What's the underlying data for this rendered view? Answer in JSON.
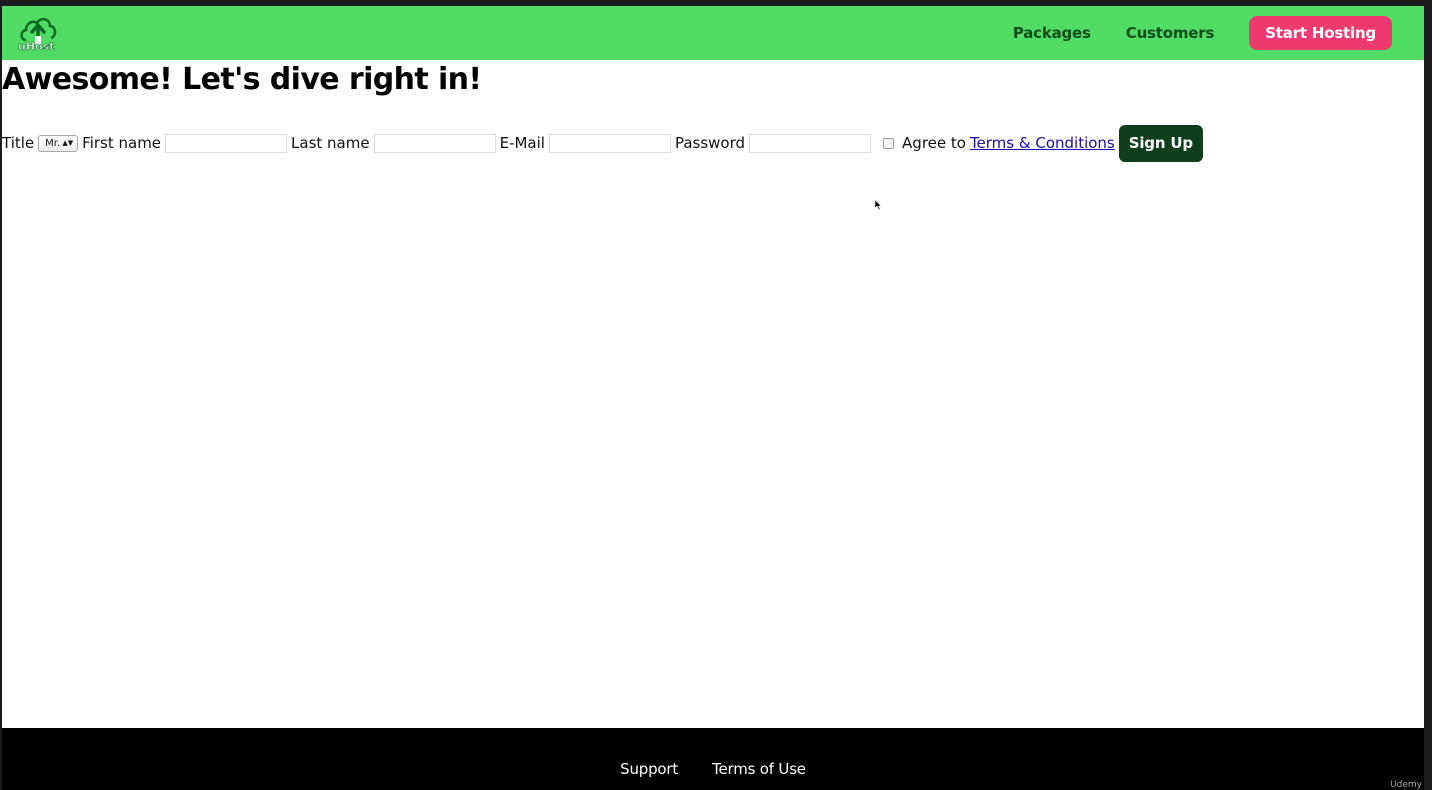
{
  "brand": {
    "logo_text": "uHost",
    "colors": {
      "header": "#51dc65",
      "cta": "#ef3a6f",
      "signup": "#0f3e1c",
      "footer": "#000000"
    }
  },
  "nav": {
    "links": [
      "Packages",
      "Customers"
    ],
    "cta": "Start Hosting"
  },
  "main": {
    "heading": "Awesome! Let's dive right in!"
  },
  "form": {
    "title_label": "Title",
    "title_selected": "Mr.",
    "first_name_label": "First name",
    "first_name_value": "",
    "last_name_label": "Last name",
    "last_name_value": "",
    "email_label": "E-Mail",
    "email_value": "",
    "password_label": "Password",
    "password_value": "",
    "agree_checked": false,
    "agree_label": "Agree to",
    "terms_link": "Terms & Conditions",
    "submit": "Sign Up"
  },
  "footer": {
    "links": [
      "Support",
      "Terms of Use"
    ]
  },
  "watermark": "Udemy"
}
